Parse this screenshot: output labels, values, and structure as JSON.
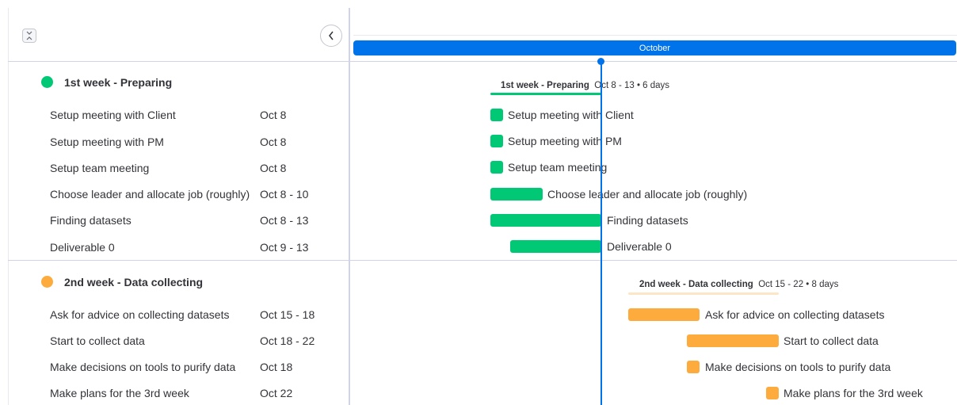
{
  "colors": {
    "accent": "#0073ea",
    "group1": "#00c875",
    "group2": "#fdab3d",
    "group2_light": "#fde6c6"
  },
  "timeline": {
    "month": "October"
  },
  "groups": [
    {
      "title": "1st week - Preparing",
      "summary_title": "1st week - Preparing",
      "summary_meta": "Oct 8 - 13 • 6 days",
      "tasks": [
        {
          "name": "Setup meeting with Client",
          "date": "Oct 8"
        },
        {
          "name": "Setup meeting with PM",
          "date": "Oct 8"
        },
        {
          "name": "Setup team meeting",
          "date": "Oct 8"
        },
        {
          "name": "Choose leader and allocate job (roughly)",
          "date": "Oct 8 - 10"
        },
        {
          "name": "Finding datasets",
          "date": "Oct 8 - 13"
        },
        {
          "name": "Deliverable 0",
          "date": "Oct 9 - 13"
        }
      ]
    },
    {
      "title": "2nd week - Data collecting",
      "summary_title": "2nd week - Data collecting",
      "summary_meta": "Oct 15 - 22 • 8 days",
      "tasks": [
        {
          "name": "Ask for advice on collecting datasets",
          "date": "Oct 15 - 18"
        },
        {
          "name": "Start to collect data",
          "date": "Oct 18 - 22"
        },
        {
          "name": "Make decisions on tools to purify data",
          "date": "Oct 18"
        },
        {
          "name": "Make plans for the 3rd week",
          "date": "Oct 22"
        }
      ]
    }
  ]
}
